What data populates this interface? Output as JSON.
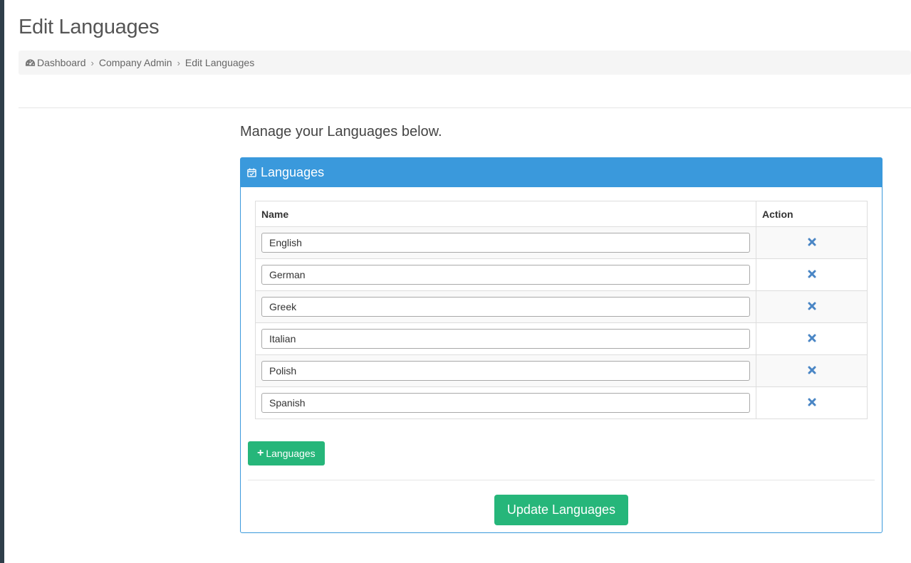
{
  "page": {
    "title": "Edit Languages",
    "intro": "Manage your Languages below."
  },
  "breadcrumb": {
    "items": [
      {
        "label": "Dashboard",
        "icon": "dashboard-icon"
      },
      {
        "label": "Company Admin"
      },
      {
        "label": "Edit Languages"
      }
    ]
  },
  "panel": {
    "title": "Languages",
    "icon": "calendar-check-icon",
    "color": "#3a99dc"
  },
  "table": {
    "columns": [
      "Name",
      "Action"
    ],
    "rows": [
      {
        "name": "English"
      },
      {
        "name": "German"
      },
      {
        "name": "Greek"
      },
      {
        "name": "Italian"
      },
      {
        "name": "Polish"
      },
      {
        "name": "Spanish"
      }
    ],
    "delete_icon": "close-icon"
  },
  "buttons": {
    "add_label": "Languages",
    "add_icon": "plus-icon",
    "update_label": "Update Languages",
    "color": "#26b67a"
  }
}
